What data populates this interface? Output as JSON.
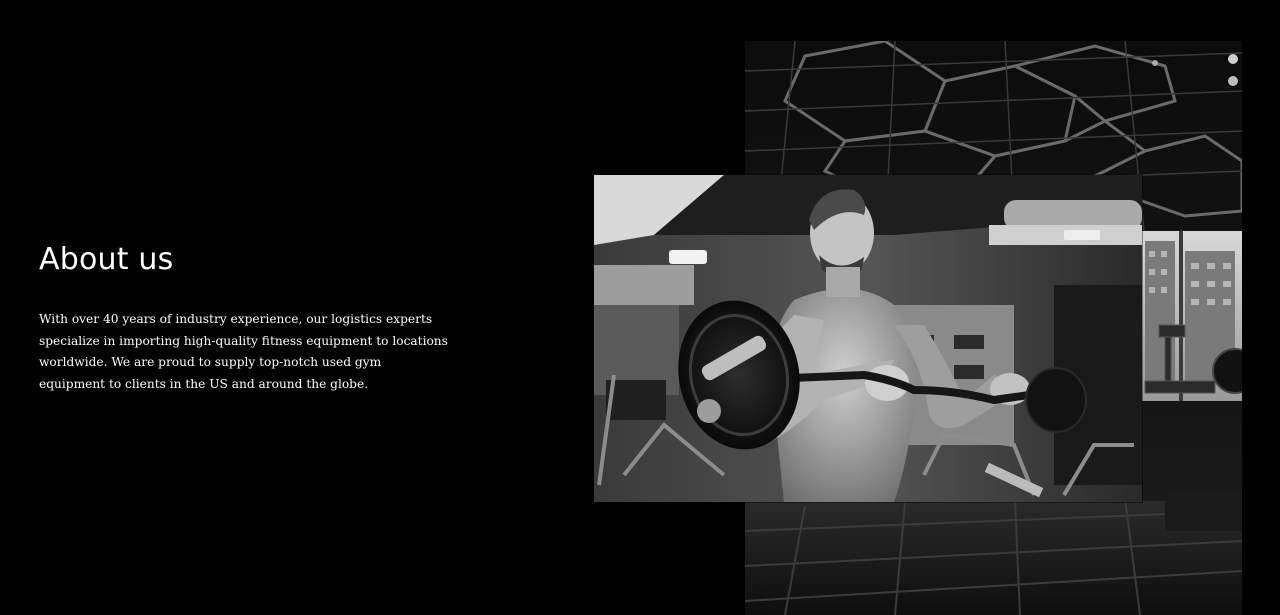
{
  "about": {
    "title": "About us",
    "body": "With over 40 years of industry experience, our logistics experts specialize in importing high-quality fitness equipment to locations worldwide. We are proud to supply top-notch used gym equipment to clients in the US and around the globe."
  },
  "images": {
    "back": {
      "icon": "gym-interior-photo"
    },
    "front": {
      "icon": "athlete-barbell-curl-photo"
    }
  },
  "colors": {
    "background": "#000000",
    "text": "#ffffff"
  }
}
